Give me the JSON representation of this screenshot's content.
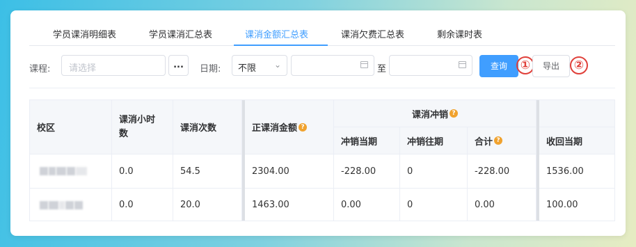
{
  "tabs": [
    {
      "label": "学员课消明细表",
      "active": false
    },
    {
      "label": "学员课消汇总表",
      "active": false
    },
    {
      "label": "课消金额汇总表",
      "active": true
    },
    {
      "label": "课消欠费汇总表",
      "active": false
    },
    {
      "label": "剩余课时表",
      "active": false
    }
  ],
  "filters": {
    "course_label": "课程:",
    "course_placeholder": "请选择",
    "more_button": "...",
    "date_label": "日期:",
    "date_mode_value": "不限",
    "range_separator": "至",
    "query_button": "查询",
    "export_button": "导出",
    "marker_1": "①",
    "marker_2": "②"
  },
  "table": {
    "headers": {
      "campus": "校区",
      "hours": "课消小时数",
      "times": "课消次数",
      "amount": "正课消金额",
      "offset_group": "课消冲销",
      "offset_current": "冲销当期",
      "offset_past": "冲销往期",
      "total": "合计",
      "recover_current": "收回当期",
      "help_glyph": "?"
    },
    "rows": [
      {
        "hours": "0.0",
        "times": "54.5",
        "amount": "2304.00",
        "offset_current": "-228.00",
        "offset_past": "0",
        "total": "-228.00",
        "recover_current": "1536.00"
      },
      {
        "hours": "0.0",
        "times": "20.0",
        "amount": "1463.00",
        "offset_current": "0.00",
        "offset_past": "0",
        "total": "0.00",
        "recover_current": "100.00"
      }
    ]
  },
  "colors": {
    "accent": "#409eff",
    "marker": "#e0403a",
    "help": "#f0a22e"
  }
}
